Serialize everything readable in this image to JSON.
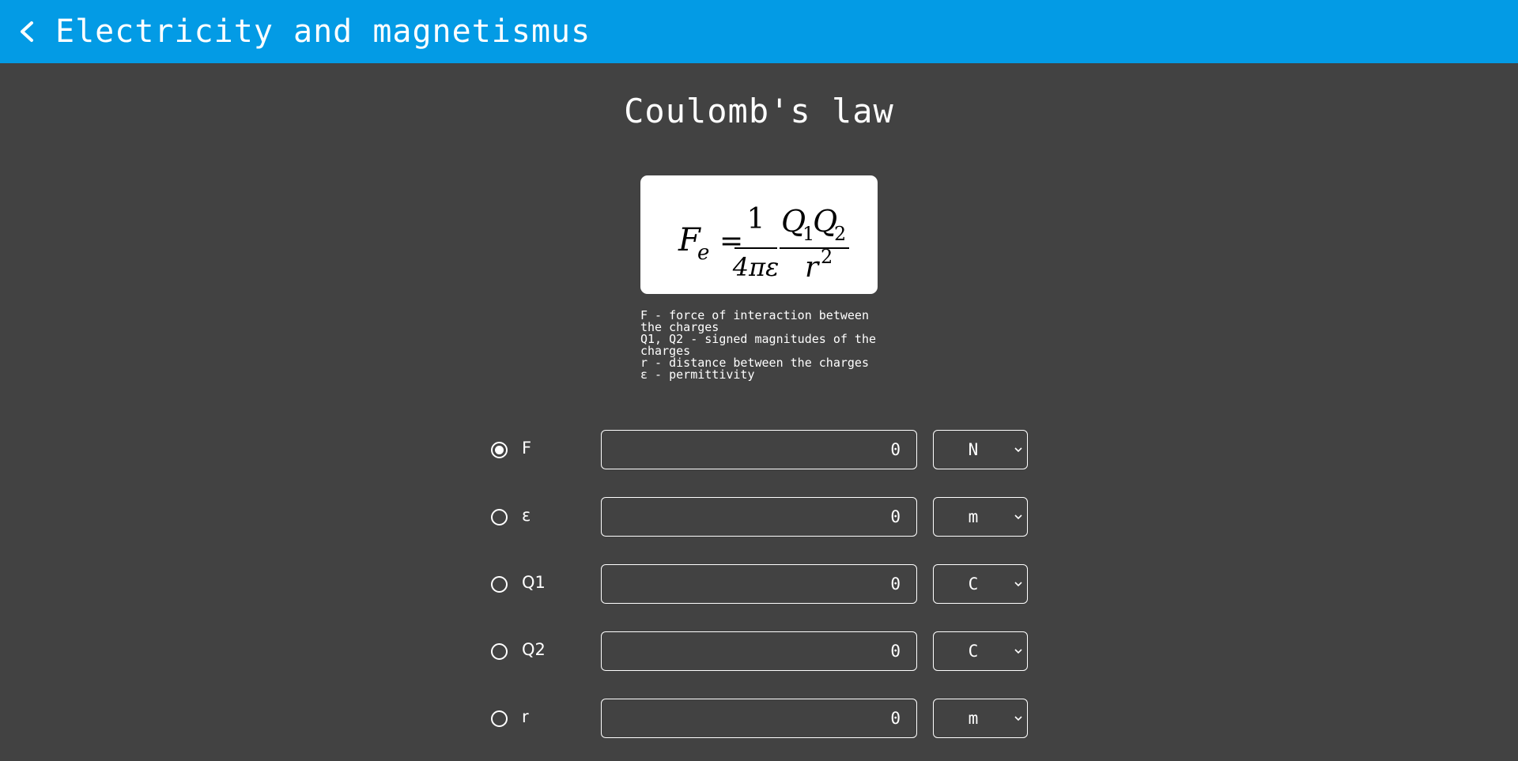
{
  "appbar": {
    "title": "Electricity and magnetismus",
    "back_icon": "chevron-left-icon"
  },
  "page": {
    "title": "Coulomb's law"
  },
  "formula": {
    "lhs": "F",
    "lhs_sub": "e",
    "equals": "=",
    "frac1_num": "1",
    "frac1_den": "4πε",
    "frac2_num_a": "Q",
    "frac2_num_a_sub": "1",
    "frac2_num_b": "Q",
    "frac2_num_b_sub": "2",
    "frac2_den": "r",
    "frac2_den_sup": "2"
  },
  "legend": [
    "F - force of interaction between the charges",
    "Q1, Q2 - signed magnitudes of the charges",
    "r - distance between the charges",
    "ε - permittivity"
  ],
  "rows": [
    {
      "label": "F",
      "value": "0",
      "unit": "N",
      "selected": true
    },
    {
      "label": "ε",
      "value": "0",
      "unit": "m",
      "selected": false
    },
    {
      "label": "Q1",
      "value": "0",
      "unit": "C",
      "selected": false
    },
    {
      "label": "Q2",
      "value": "0",
      "unit": "C",
      "selected": false
    },
    {
      "label": "r",
      "value": "0",
      "unit": "m",
      "selected": false
    }
  ],
  "colors": {
    "appbar": "#039be5",
    "background": "#424242",
    "foreground": "#ffffff"
  }
}
